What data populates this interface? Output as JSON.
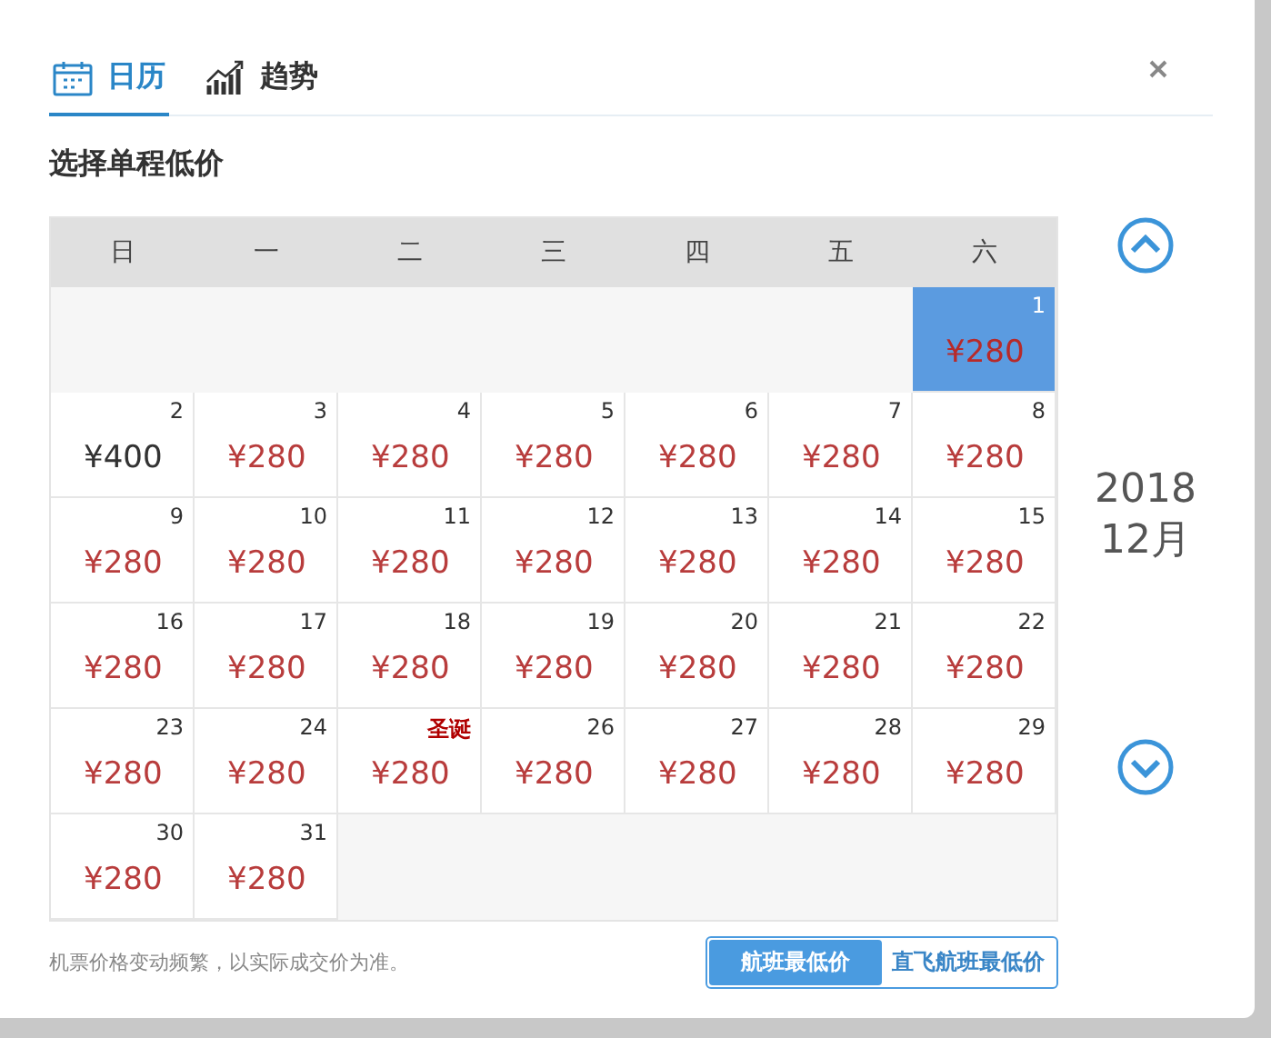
{
  "tabs": [
    {
      "label": "日历",
      "kind": "calendar",
      "selected": true
    },
    {
      "label": "趋势",
      "kind": "trend",
      "selected": false
    }
  ],
  "heading": "选择单程低价",
  "calendar": {
    "weekdays": [
      "日",
      "一",
      "二",
      "三",
      "四",
      "五",
      "六"
    ],
    "weeks": [
      [
        {
          "kind": "empty"
        },
        {
          "kind": "empty"
        },
        {
          "kind": "empty"
        },
        {
          "kind": "empty"
        },
        {
          "kind": "empty"
        },
        {
          "kind": "empty"
        },
        {
          "kind": "day",
          "day": "1",
          "price": "¥280",
          "lowest": true,
          "selected": true
        }
      ],
      [
        {
          "kind": "day",
          "day": "2",
          "price": "¥400",
          "lowest": false,
          "selected": false
        },
        {
          "kind": "day",
          "day": "3",
          "price": "¥280",
          "lowest": true,
          "selected": false
        },
        {
          "kind": "day",
          "day": "4",
          "price": "¥280",
          "lowest": true,
          "selected": false
        },
        {
          "kind": "day",
          "day": "5",
          "price": "¥280",
          "lowest": true,
          "selected": false
        },
        {
          "kind": "day",
          "day": "6",
          "price": "¥280",
          "lowest": true,
          "selected": false
        },
        {
          "kind": "day",
          "day": "7",
          "price": "¥280",
          "lowest": true,
          "selected": false
        },
        {
          "kind": "day",
          "day": "8",
          "price": "¥280",
          "lowest": true,
          "selected": false
        }
      ],
      [
        {
          "kind": "day",
          "day": "9",
          "price": "¥280",
          "lowest": true,
          "selected": false
        },
        {
          "kind": "day",
          "day": "10",
          "price": "¥280",
          "lowest": true,
          "selected": false
        },
        {
          "kind": "day",
          "day": "11",
          "price": "¥280",
          "lowest": true,
          "selected": false
        },
        {
          "kind": "day",
          "day": "12",
          "price": "¥280",
          "lowest": true,
          "selected": false
        },
        {
          "kind": "day",
          "day": "13",
          "price": "¥280",
          "lowest": true,
          "selected": false
        },
        {
          "kind": "day",
          "day": "14",
          "price": "¥280",
          "lowest": true,
          "selected": false
        },
        {
          "kind": "day",
          "day": "15",
          "price": "¥280",
          "lowest": true,
          "selected": false
        }
      ],
      [
        {
          "kind": "day",
          "day": "16",
          "price": "¥280",
          "lowest": true,
          "selected": false
        },
        {
          "kind": "day",
          "day": "17",
          "price": "¥280",
          "lowest": true,
          "selected": false
        },
        {
          "kind": "day",
          "day": "18",
          "price": "¥280",
          "lowest": true,
          "selected": false
        },
        {
          "kind": "day",
          "day": "19",
          "price": "¥280",
          "lowest": true,
          "selected": false
        },
        {
          "kind": "day",
          "day": "20",
          "price": "¥280",
          "lowest": true,
          "selected": false
        },
        {
          "kind": "day",
          "day": "21",
          "price": "¥280",
          "lowest": true,
          "selected": false
        },
        {
          "kind": "day",
          "day": "22",
          "price": "¥280",
          "lowest": true,
          "selected": false
        }
      ],
      [
        {
          "kind": "day",
          "day": "23",
          "price": "¥280",
          "lowest": true,
          "selected": false
        },
        {
          "kind": "day",
          "day": "24",
          "price": "¥280",
          "lowest": true,
          "selected": false
        },
        {
          "kind": "holiday",
          "day": "圣诞",
          "price": "¥280",
          "lowest": true,
          "selected": false
        },
        {
          "kind": "day",
          "day": "26",
          "price": "¥280",
          "lowest": true,
          "selected": false
        },
        {
          "kind": "day",
          "day": "27",
          "price": "¥280",
          "lowest": true,
          "selected": false
        },
        {
          "kind": "day",
          "day": "28",
          "price": "¥280",
          "lowest": true,
          "selected": false
        },
        {
          "kind": "day",
          "day": "29",
          "price": "¥280",
          "lowest": true,
          "selected": false
        }
      ],
      [
        {
          "kind": "day",
          "day": "30",
          "price": "¥280",
          "lowest": true,
          "selected": false
        },
        {
          "kind": "day",
          "day": "31",
          "price": "¥280",
          "lowest": true,
          "selected": false
        },
        {
          "kind": "empty"
        },
        {
          "kind": "empty"
        },
        {
          "kind": "empty"
        },
        {
          "kind": "empty"
        },
        {
          "kind": "empty"
        }
      ]
    ]
  },
  "month_nav": {
    "year": "2018",
    "month": "12月"
  },
  "note": "机票价格变动频繁，以实际成交价为准。",
  "filters": [
    {
      "label": "航班最低价",
      "selected": true
    },
    {
      "label": "直飞航班最低价",
      "selected": false
    }
  ]
}
